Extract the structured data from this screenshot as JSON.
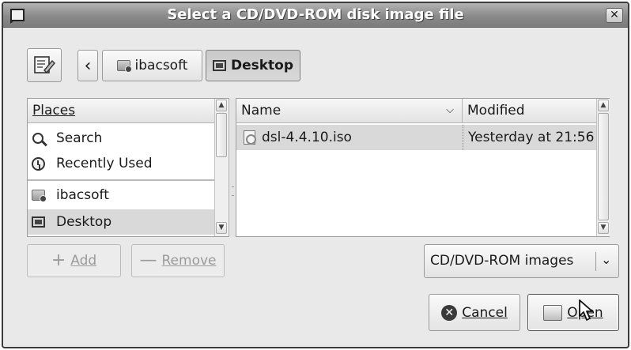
{
  "window": {
    "title": "Select a CD/DVD-ROM disk image file",
    "close_glyph": "✕"
  },
  "pathbar": {
    "back_glyph": "‹",
    "crumbs": [
      {
        "label": "ibacsoft",
        "icon": "network-folder-icon"
      },
      {
        "label": "Desktop",
        "icon": "desktop-icon",
        "active": true
      }
    ]
  },
  "places": {
    "header": "Places",
    "items": [
      {
        "label": "Search",
        "icon": "search-icon"
      },
      {
        "label": "Recently Used",
        "icon": "recently-used-icon"
      },
      {
        "label": "ibacsoft",
        "icon": "network-folder-icon"
      },
      {
        "label": "Desktop",
        "icon": "desktop-icon",
        "selected": true
      }
    ]
  },
  "files": {
    "columns": [
      "Name",
      "Modified"
    ],
    "rows": [
      {
        "name": "dsl-4.4.10.iso",
        "modified": "Yesterday at 21:56",
        "icon": "iso-file-icon",
        "selected": true
      }
    ]
  },
  "buttons": {
    "add": "Add",
    "remove": "Remove",
    "cancel": "Cancel",
    "open": "Open"
  },
  "filter": {
    "selected": "CD/DVD-ROM images"
  },
  "colors": {
    "titlebar": "#8a8a8a",
    "selection": "#d9d9d9",
    "window_bg": "#e9e9e9"
  }
}
